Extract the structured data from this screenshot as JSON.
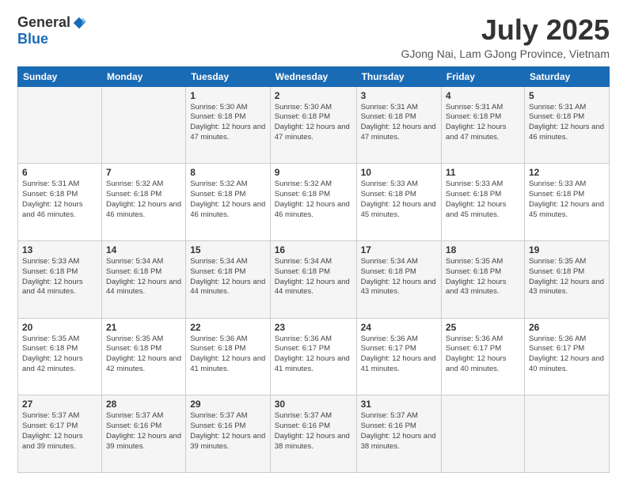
{
  "logo": {
    "general": "General",
    "blue": "Blue"
  },
  "header": {
    "month": "July 2025",
    "location": "GJong Nai, Lam GJong Province, Vietnam"
  },
  "weekdays": [
    "Sunday",
    "Monday",
    "Tuesday",
    "Wednesday",
    "Thursday",
    "Friday",
    "Saturday"
  ],
  "weeks": [
    [
      {
        "day": "",
        "sunrise": "",
        "sunset": "",
        "daylight": ""
      },
      {
        "day": "",
        "sunrise": "",
        "sunset": "",
        "daylight": ""
      },
      {
        "day": "1",
        "sunrise": "Sunrise: 5:30 AM",
        "sunset": "Sunset: 6:18 PM",
        "daylight": "Daylight: 12 hours and 47 minutes."
      },
      {
        "day": "2",
        "sunrise": "Sunrise: 5:30 AM",
        "sunset": "Sunset: 6:18 PM",
        "daylight": "Daylight: 12 hours and 47 minutes."
      },
      {
        "day": "3",
        "sunrise": "Sunrise: 5:31 AM",
        "sunset": "Sunset: 6:18 PM",
        "daylight": "Daylight: 12 hours and 47 minutes."
      },
      {
        "day": "4",
        "sunrise": "Sunrise: 5:31 AM",
        "sunset": "Sunset: 6:18 PM",
        "daylight": "Daylight: 12 hours and 47 minutes."
      },
      {
        "day": "5",
        "sunrise": "Sunrise: 5:31 AM",
        "sunset": "Sunset: 6:18 PM",
        "daylight": "Daylight: 12 hours and 46 minutes."
      }
    ],
    [
      {
        "day": "6",
        "sunrise": "Sunrise: 5:31 AM",
        "sunset": "Sunset: 6:18 PM",
        "daylight": "Daylight: 12 hours and 46 minutes."
      },
      {
        "day": "7",
        "sunrise": "Sunrise: 5:32 AM",
        "sunset": "Sunset: 6:18 PM",
        "daylight": "Daylight: 12 hours and 46 minutes."
      },
      {
        "day": "8",
        "sunrise": "Sunrise: 5:32 AM",
        "sunset": "Sunset: 6:18 PM",
        "daylight": "Daylight: 12 hours and 46 minutes."
      },
      {
        "day": "9",
        "sunrise": "Sunrise: 5:32 AM",
        "sunset": "Sunset: 6:18 PM",
        "daylight": "Daylight: 12 hours and 46 minutes."
      },
      {
        "day": "10",
        "sunrise": "Sunrise: 5:33 AM",
        "sunset": "Sunset: 6:18 PM",
        "daylight": "Daylight: 12 hours and 45 minutes."
      },
      {
        "day": "11",
        "sunrise": "Sunrise: 5:33 AM",
        "sunset": "Sunset: 6:18 PM",
        "daylight": "Daylight: 12 hours and 45 minutes."
      },
      {
        "day": "12",
        "sunrise": "Sunrise: 5:33 AM",
        "sunset": "Sunset: 6:18 PM",
        "daylight": "Daylight: 12 hours and 45 minutes."
      }
    ],
    [
      {
        "day": "13",
        "sunrise": "Sunrise: 5:33 AM",
        "sunset": "Sunset: 6:18 PM",
        "daylight": "Daylight: 12 hours and 44 minutes."
      },
      {
        "day": "14",
        "sunrise": "Sunrise: 5:34 AM",
        "sunset": "Sunset: 6:18 PM",
        "daylight": "Daylight: 12 hours and 44 minutes."
      },
      {
        "day": "15",
        "sunrise": "Sunrise: 5:34 AM",
        "sunset": "Sunset: 6:18 PM",
        "daylight": "Daylight: 12 hours and 44 minutes."
      },
      {
        "day": "16",
        "sunrise": "Sunrise: 5:34 AM",
        "sunset": "Sunset: 6:18 PM",
        "daylight": "Daylight: 12 hours and 44 minutes."
      },
      {
        "day": "17",
        "sunrise": "Sunrise: 5:34 AM",
        "sunset": "Sunset: 6:18 PM",
        "daylight": "Daylight: 12 hours and 43 minutes."
      },
      {
        "day": "18",
        "sunrise": "Sunrise: 5:35 AM",
        "sunset": "Sunset: 6:18 PM",
        "daylight": "Daylight: 12 hours and 43 minutes."
      },
      {
        "day": "19",
        "sunrise": "Sunrise: 5:35 AM",
        "sunset": "Sunset: 6:18 PM",
        "daylight": "Daylight: 12 hours and 43 minutes."
      }
    ],
    [
      {
        "day": "20",
        "sunrise": "Sunrise: 5:35 AM",
        "sunset": "Sunset: 6:18 PM",
        "daylight": "Daylight: 12 hours and 42 minutes."
      },
      {
        "day": "21",
        "sunrise": "Sunrise: 5:35 AM",
        "sunset": "Sunset: 6:18 PM",
        "daylight": "Daylight: 12 hours and 42 minutes."
      },
      {
        "day": "22",
        "sunrise": "Sunrise: 5:36 AM",
        "sunset": "Sunset: 6:18 PM",
        "daylight": "Daylight: 12 hours and 41 minutes."
      },
      {
        "day": "23",
        "sunrise": "Sunrise: 5:36 AM",
        "sunset": "Sunset: 6:17 PM",
        "daylight": "Daylight: 12 hours and 41 minutes."
      },
      {
        "day": "24",
        "sunrise": "Sunrise: 5:36 AM",
        "sunset": "Sunset: 6:17 PM",
        "daylight": "Daylight: 12 hours and 41 minutes."
      },
      {
        "day": "25",
        "sunrise": "Sunrise: 5:36 AM",
        "sunset": "Sunset: 6:17 PM",
        "daylight": "Daylight: 12 hours and 40 minutes."
      },
      {
        "day": "26",
        "sunrise": "Sunrise: 5:36 AM",
        "sunset": "Sunset: 6:17 PM",
        "daylight": "Daylight: 12 hours and 40 minutes."
      }
    ],
    [
      {
        "day": "27",
        "sunrise": "Sunrise: 5:37 AM",
        "sunset": "Sunset: 6:17 PM",
        "daylight": "Daylight: 12 hours and 39 minutes."
      },
      {
        "day": "28",
        "sunrise": "Sunrise: 5:37 AM",
        "sunset": "Sunset: 6:16 PM",
        "daylight": "Daylight: 12 hours and 39 minutes."
      },
      {
        "day": "29",
        "sunrise": "Sunrise: 5:37 AM",
        "sunset": "Sunset: 6:16 PM",
        "daylight": "Daylight: 12 hours and 39 minutes."
      },
      {
        "day": "30",
        "sunrise": "Sunrise: 5:37 AM",
        "sunset": "Sunset: 6:16 PM",
        "daylight": "Daylight: 12 hours and 38 minutes."
      },
      {
        "day": "31",
        "sunrise": "Sunrise: 5:37 AM",
        "sunset": "Sunset: 6:16 PM",
        "daylight": "Daylight: 12 hours and 38 minutes."
      },
      {
        "day": "",
        "sunrise": "",
        "sunset": "",
        "daylight": ""
      },
      {
        "day": "",
        "sunrise": "",
        "sunset": "",
        "daylight": ""
      }
    ]
  ]
}
